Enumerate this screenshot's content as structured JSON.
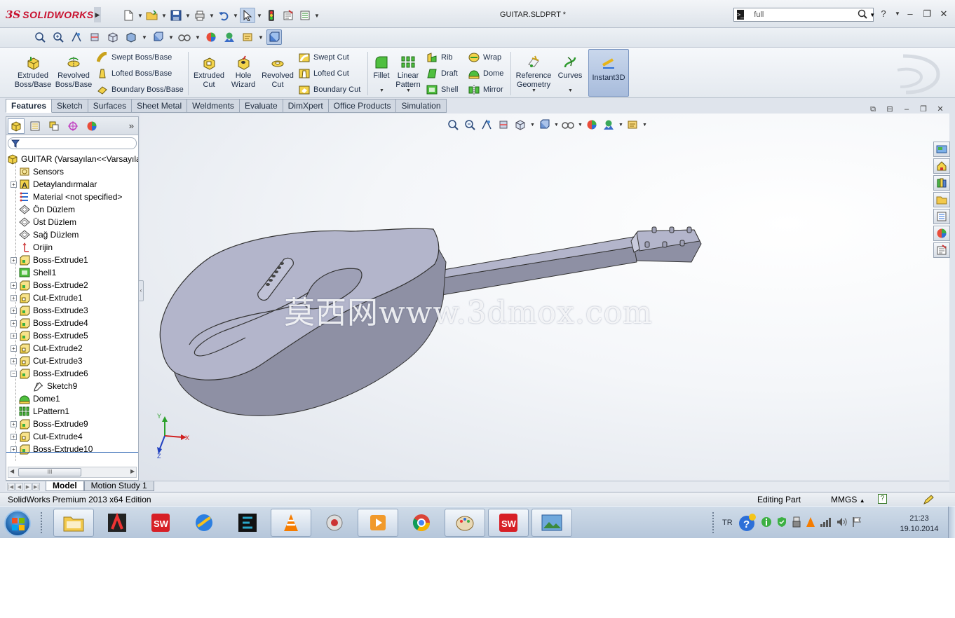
{
  "app": {
    "logo_prefix": "3S",
    "logo_name": "SOLIDWORKS",
    "document_title": "GUITAR.SLDPRT *",
    "search_value": "full"
  },
  "command_manager": {
    "extruded_boss": "Extruded Boss/Base",
    "revolved_boss": "Revolved Boss/Base",
    "swept_boss": "Swept Boss/Base",
    "lofted_boss": "Lofted Boss/Base",
    "boundary_boss": "Boundary Boss/Base",
    "extruded_cut": "Extruded Cut",
    "hole_wizard": "Hole Wizard",
    "revolved_cut": "Revolved Cut",
    "swept_cut": "Swept Cut",
    "lofted_cut": "Lofted Cut",
    "boundary_cut": "Boundary Cut",
    "fillet": "Fillet",
    "linear_pattern": "Linear Pattern",
    "rib": "Rib",
    "draft": "Draft",
    "shell": "Shell",
    "wrap": "Wrap",
    "dome": "Dome",
    "mirror": "Mirror",
    "reference_geometry": "Reference Geometry",
    "curves": "Curves",
    "instant3d": "Instant3D"
  },
  "tabs": [
    "Features",
    "Sketch",
    "Surfaces",
    "Sheet Metal",
    "Weldments",
    "Evaluate",
    "DimXpert",
    "Office Products",
    "Simulation"
  ],
  "feature_tree": [
    {
      "label": "GUITAR  (Varsayılan<<Varsayıla",
      "icon": "part",
      "level": 0,
      "exp": "none"
    },
    {
      "label": "Sensors",
      "icon": "sensor",
      "level": 1,
      "exp": "none"
    },
    {
      "label": "Detaylandırmalar",
      "icon": "annotation",
      "level": 1,
      "exp": "plus"
    },
    {
      "label": "Material <not specified>",
      "icon": "material",
      "level": 1,
      "exp": "none"
    },
    {
      "label": "Ön Düzlem",
      "icon": "plane",
      "level": 1,
      "exp": "none"
    },
    {
      "label": "Üst Düzlem",
      "icon": "plane",
      "level": 1,
      "exp": "none"
    },
    {
      "label": "Sağ Düzlem",
      "icon": "plane",
      "level": 1,
      "exp": "none"
    },
    {
      "label": "Orijin",
      "icon": "origin",
      "level": 1,
      "exp": "none"
    },
    {
      "label": "Boss-Extrude1",
      "icon": "extrude",
      "level": 1,
      "exp": "plus"
    },
    {
      "label": "Shell1",
      "icon": "shell",
      "level": 1,
      "exp": "none"
    },
    {
      "label": "Boss-Extrude2",
      "icon": "extrude",
      "level": 1,
      "exp": "plus"
    },
    {
      "label": "Cut-Extrude1",
      "icon": "cut",
      "level": 1,
      "exp": "plus"
    },
    {
      "label": "Boss-Extrude3",
      "icon": "extrude",
      "level": 1,
      "exp": "plus"
    },
    {
      "label": "Boss-Extrude4",
      "icon": "extrude",
      "level": 1,
      "exp": "plus"
    },
    {
      "label": "Boss-Extrude5",
      "icon": "extrude",
      "level": 1,
      "exp": "plus"
    },
    {
      "label": "Cut-Extrude2",
      "icon": "cut",
      "level": 1,
      "exp": "plus"
    },
    {
      "label": "Cut-Extrude3",
      "icon": "cut",
      "level": 1,
      "exp": "plus"
    },
    {
      "label": "Boss-Extrude6",
      "icon": "extrude",
      "level": 1,
      "exp": "minus"
    },
    {
      "label": "Sketch9",
      "icon": "sketch",
      "level": 2,
      "exp": "none"
    },
    {
      "label": "Dome1",
      "icon": "dome",
      "level": 1,
      "exp": "none"
    },
    {
      "label": "LPattern1",
      "icon": "pattern",
      "level": 1,
      "exp": "none"
    },
    {
      "label": "Boss-Extrude9",
      "icon": "extrude",
      "level": 1,
      "exp": "plus"
    },
    {
      "label": "Cut-Extrude4",
      "icon": "cut",
      "level": 1,
      "exp": "plus"
    },
    {
      "label": "Boss-Extrude10",
      "icon": "extrude",
      "level": 1,
      "exp": "plus"
    }
  ],
  "fm_scroll_thumb": "III",
  "graphics": {
    "watermark": "莫西网www.3dmox.com",
    "triad_x": "X",
    "triad_y": "Y",
    "triad_z": "Z"
  },
  "bottom_tabs": [
    "Model",
    "Motion Study 1"
  ],
  "status": {
    "edition": "SolidWorks Premium 2013 x64 Edition",
    "mode": "Editing Part",
    "units": "MMGS",
    "help": "?"
  },
  "taskbar": {
    "lang": "TR",
    "time": "21:23",
    "date": "19.10.2014"
  },
  "colors": {
    "accent": "#c8102e",
    "model_face": "#b3b5cb",
    "model_side": "#8e90a4"
  }
}
